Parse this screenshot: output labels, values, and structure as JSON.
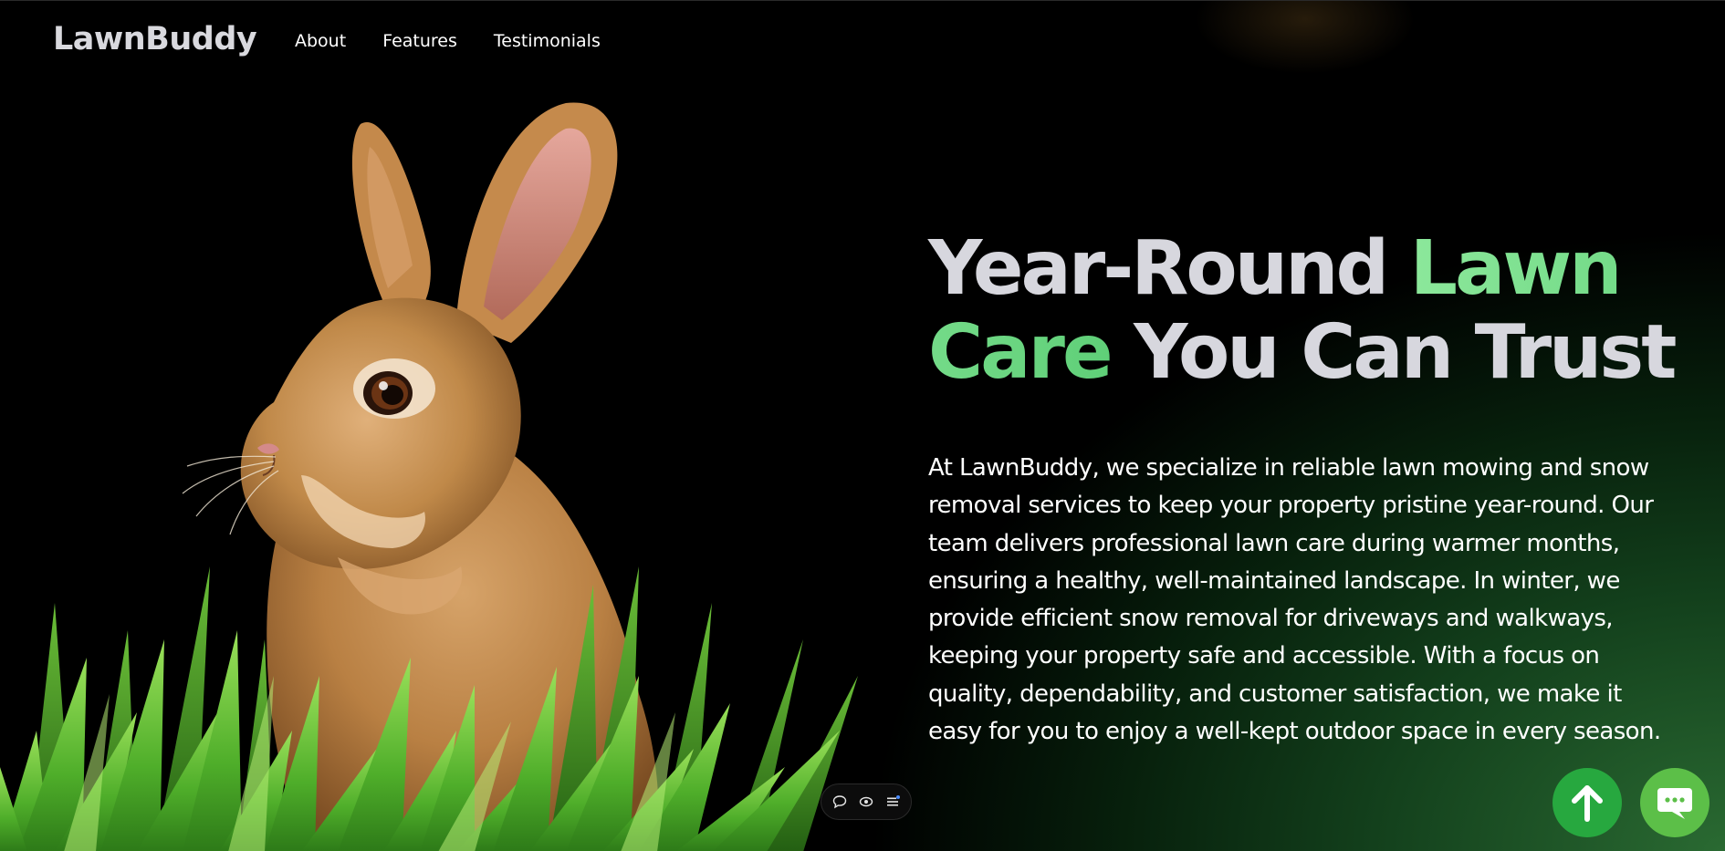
{
  "brand": {
    "name": "LawnBuddy"
  },
  "nav": {
    "items": [
      {
        "label": "About"
      },
      {
        "label": "Features"
      },
      {
        "label": "Testimonials"
      }
    ]
  },
  "hero": {
    "title_part1": "Year-Round ",
    "title_accent": "Lawn Care",
    "title_part2": " You Can Trust",
    "description": "At LawnBuddy, we specialize in reliable lawn mowing and snow removal services to keep your property pristine year-round. Our team delivers professional lawn care during warmer months, ensuring a healthy, well-maintained landscape. In winter, we provide efficient snow removal for driveways and walkways, keeping your property safe and accessible. With a focus on quality, dependability, and customer satisfaction, we make it easy for you to enjoy a well-kept outdoor space in every season."
  },
  "toolbar": {
    "icons": [
      "comment-icon",
      "eye-icon",
      "menu-icon"
    ]
  },
  "actions": {
    "scroll_top_icon": "arrow-up-icon",
    "chat_icon": "chat-bubble-icon"
  },
  "colors": {
    "accent_green": "#6ddc85",
    "scroll_top_bg": "#27a83f",
    "chat_bg": "#5cbf48",
    "title_gray": "#d7d7de"
  }
}
